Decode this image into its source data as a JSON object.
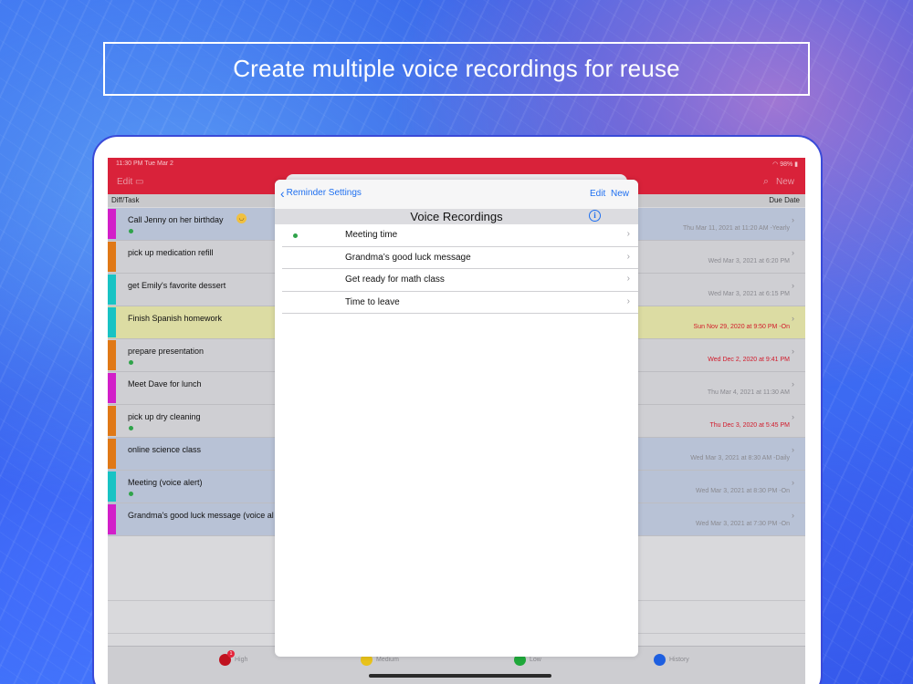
{
  "banner": {
    "text": "Create multiple voice recordings for reuse"
  },
  "status": {
    "time": "11:30 PM  Tue Mar 2",
    "battery": "98%"
  },
  "toolbar": {
    "edit": "Edit",
    "new": "New"
  },
  "columns": {
    "left": "Diff/Task",
    "right": "Due Date"
  },
  "tasks": [
    {
      "name": "Call Jenny on her birthday",
      "date": "Thu Mar 11, 2021 at 11:20 AM -Yearly",
      "color": "#d21fc9",
      "dot": true,
      "emoji": true,
      "hl": "blue",
      "red": false
    },
    {
      "name": "pick up medication refill",
      "date": "Wed Mar 3, 2021 at 6:20 PM",
      "color": "#e07816",
      "dot": false,
      "emoji": false,
      "hl": "",
      "red": false
    },
    {
      "name": "get Emily's favorite dessert",
      "date": "Wed Mar 3, 2021 at 6:15 PM",
      "color": "#18c3c4",
      "dot": false,
      "emoji": false,
      "hl": "",
      "red": false
    },
    {
      "name": "Finish Spanish homework",
      "date": "Sun Nov 29, 2020 at 9:50 PM -On",
      "color": "#18c3c4",
      "dot": false,
      "emoji": false,
      "hl": "yellow",
      "red": true
    },
    {
      "name": "prepare presentation",
      "date": "Wed Dec 2, 2020 at 9:41 PM",
      "color": "#e07816",
      "dot": true,
      "emoji": false,
      "hl": "",
      "red": true
    },
    {
      "name": "Meet Dave for lunch",
      "date": "Thu Mar 4, 2021 at 11:30 AM",
      "color": "#d21fc9",
      "dot": false,
      "emoji": false,
      "hl": "",
      "red": false
    },
    {
      "name": "pick up dry cleaning",
      "date": "Thu Dec 3, 2020 at 5:45 PM",
      "color": "#e07816",
      "dot": true,
      "emoji": false,
      "hl": "",
      "red": true
    },
    {
      "name": "online science class",
      "date": "Wed Mar 3, 2021 at 8:30 AM -Daily",
      "color": "#e07816",
      "dot": false,
      "emoji": false,
      "hl": "blue",
      "red": false
    },
    {
      "name": "Meeting (voice alert)",
      "date": "Wed Mar 3, 2021 at 8:30 PM -On",
      "color": "#18c3c4",
      "dot": true,
      "emoji": false,
      "hl": "blue",
      "red": false
    },
    {
      "name": "Grandma's good luck message (voice al",
      "date": "Wed Mar 3, 2021 at 7:30 PM -On",
      "color": "#d21fc9",
      "dot": false,
      "emoji": false,
      "hl": "blue",
      "red": false
    }
  ],
  "tabs": [
    {
      "label": "High",
      "color": "#c0121f",
      "badge": "1"
    },
    {
      "label": "Medium",
      "color": "#e8c21a",
      "badge": ""
    },
    {
      "label": "Low",
      "color": "#1fa83a",
      "badge": ""
    },
    {
      "label": "History",
      "color": "#1e5fe0",
      "badge": ""
    }
  ],
  "popover": {
    "back_label": "Reminder Settings",
    "edit_label": "Edit",
    "new_label": "New",
    "section_title": "Voice Recordings",
    "items": [
      {
        "label": "Meeting time",
        "active": true
      },
      {
        "label": "Grandma’s good luck message",
        "active": false
      },
      {
        "label": "Get ready for math class",
        "active": false
      },
      {
        "label": "Time to leave",
        "active": false
      }
    ]
  }
}
